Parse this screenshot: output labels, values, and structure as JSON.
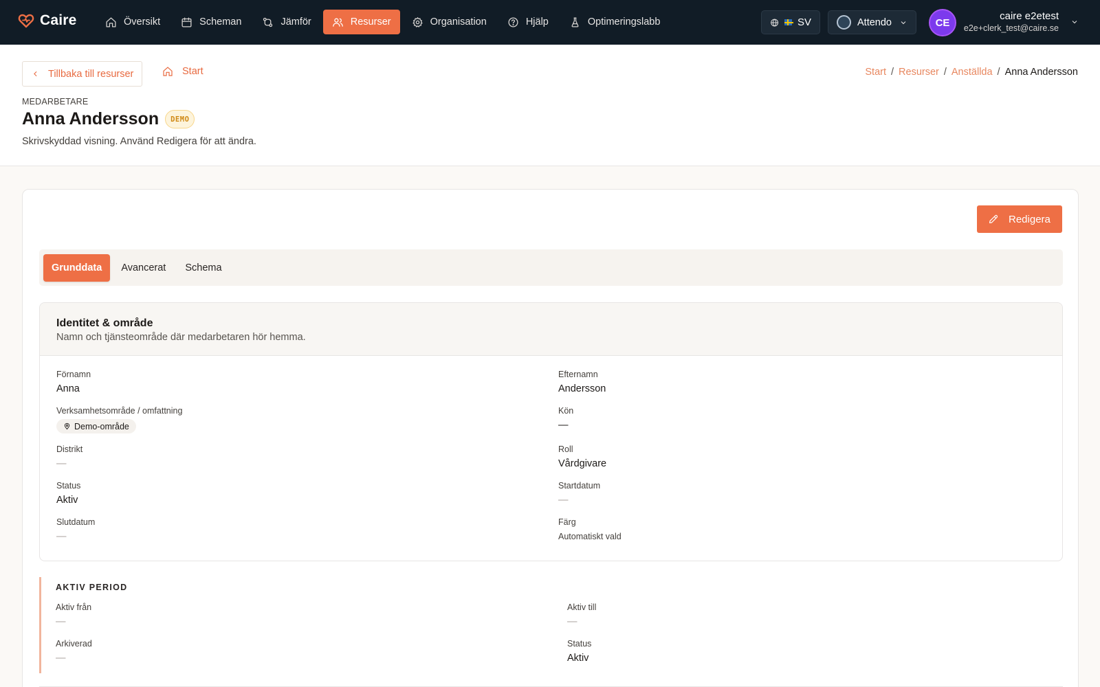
{
  "brand": {
    "name": "Caire"
  },
  "nav": {
    "items": [
      {
        "label": "Översikt",
        "icon": "home-icon"
      },
      {
        "label": "Scheman",
        "icon": "calendar-icon"
      },
      {
        "label": "Jämför",
        "icon": "compare-icon"
      },
      {
        "label": "Resurser",
        "icon": "users-icon",
        "active": true
      },
      {
        "label": "Organisation",
        "icon": "gear-icon"
      },
      {
        "label": "Hjälp",
        "icon": "help-icon"
      },
      {
        "label": "Optimeringslabb",
        "icon": "flask-icon"
      }
    ]
  },
  "language": {
    "code": "SV",
    "flag": "flag-sweden-icon"
  },
  "organization": {
    "name": "Attendo"
  },
  "user": {
    "initials": "CE",
    "name": "caire e2etest",
    "email": "e2e+clerk_test@caire.se"
  },
  "header": {
    "back_label": "Tillbaka till resurser",
    "start_label": "Start",
    "breadcrumb": [
      "Start",
      "Resurser",
      "Anställda"
    ],
    "breadcrumb_current": "Anna Andersson",
    "eyebrow": "MEDARBETARE",
    "title": "Anna Andersson",
    "badge": "DEMO",
    "subtitle": "Skrivskyddad visning. Använd Redigera för att ändra."
  },
  "actions": {
    "edit_label": "Redigera"
  },
  "tabs": [
    {
      "label": "Grunddata",
      "active": true
    },
    {
      "label": "Avancerat"
    },
    {
      "label": "Schema"
    }
  ],
  "identity": {
    "title": "Identitet & område",
    "description": "Namn och tjänsteområde där medarbetaren hör hemma.",
    "fields": {
      "first_name": {
        "label": "Förnamn",
        "value": "Anna"
      },
      "last_name": {
        "label": "Efternamn",
        "value": "Andersson"
      },
      "area": {
        "label": "Verksamhetsområde / omfattning",
        "value": "Demo-område"
      },
      "gender": {
        "label": "Kön",
        "value": "—"
      },
      "district": {
        "label": "Distrikt",
        "value": "—"
      },
      "role": {
        "label": "Roll",
        "value": "Vårdgivare"
      },
      "status": {
        "label": "Status",
        "value": "Aktiv"
      },
      "start_date": {
        "label": "Startdatum",
        "value": "—"
      },
      "end_date": {
        "label": "Slutdatum",
        "value": "—"
      },
      "color": {
        "label": "Färg",
        "value": "Automatiskt vald"
      }
    }
  },
  "active_period": {
    "title": "AKTIV PERIOD",
    "fields": {
      "active_from": {
        "label": "Aktiv från",
        "value": "—"
      },
      "active_to": {
        "label": "Aktiv till",
        "value": "—"
      },
      "archived": {
        "label": "Arkiverad",
        "value": "—"
      },
      "status": {
        "label": "Status",
        "value": "Aktiv"
      }
    }
  },
  "colors": {
    "accent": "#ee6f45",
    "nav_bg": "#111c26",
    "badge_bg": "#fdf4dc"
  }
}
